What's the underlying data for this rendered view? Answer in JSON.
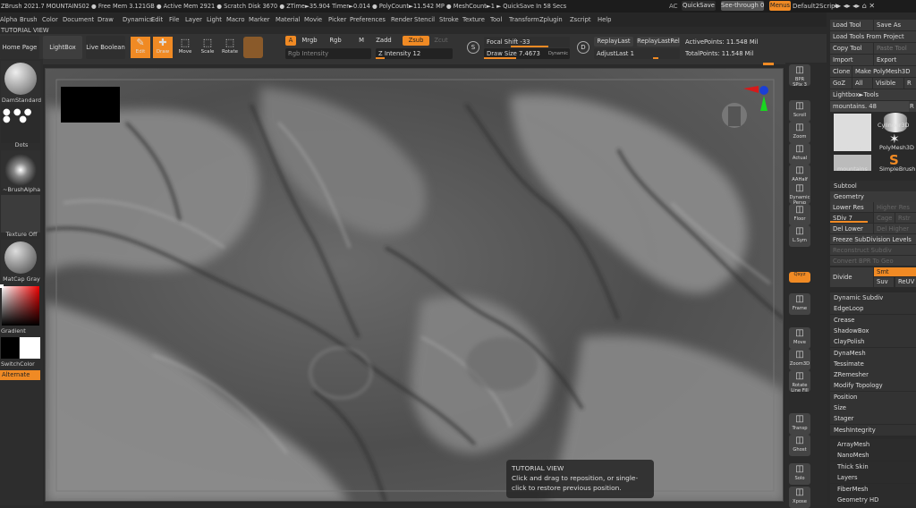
{
  "titlebar": {
    "info": "ZBrush 2021.7   MOUNTAINS02  ● Free Mem 3.121GB ● Active Mem 2921 ● Scratch Disk 3670 ● ZTime►35.904 Timer►0.014 ● PolyCount►11.542 MP  ● MeshCount►1  ► QuickSave In 58 Secs",
    "ac": "AC",
    "quicksave": "QuickSave",
    "seethrough": "See-through  0",
    "menus": "Menus",
    "script": "Default2Script"
  },
  "menubar": [
    "Alpha",
    "Brush",
    "Color",
    "Document",
    "Draw",
    "Dynamics",
    "Edit",
    "File",
    "Layer",
    "Light",
    "Macro",
    "Marker",
    "Material",
    "Movie",
    "Picker",
    "Preferences",
    "Render",
    "Stencil",
    "Stroke",
    "Texture",
    "Tool",
    "Transform",
    "Zplugin",
    "Zscript",
    "Help"
  ],
  "tutorial_label": "TUTORIAL VIEW",
  "shelf": {
    "home": "Home Page",
    "lightbox": "LightBox",
    "liveboolean": "Live Boolean",
    "edit": "Edit",
    "draw": "Draw",
    "move": "Move",
    "scale": "Scale",
    "rotate": "Rotate",
    "a": "A",
    "mrgb": "Mrgb",
    "rgb": "Rgb",
    "m": "M",
    "zadd": "Zadd",
    "zsub": "Zsub",
    "zcut": "Zcut",
    "rgb_intensity": "Rgb Intensity",
    "z_intensity": "Z Intensity 12",
    "z_intensity_value": 12,
    "focal_shift": "Focal Shift -33",
    "draw_size": "Draw Size 7.4673",
    "dynamic": "Dynamic",
    "replaylast": "ReplayLast",
    "replaylastrel": "ReplayLastRel",
    "adjustlast": "AdjustLast 1",
    "active_points": "ActivePoints: 11.548 Mil",
    "total_points": "TotalPoints: 11.548 Mil"
  },
  "left": {
    "brush": "DamStandard",
    "stroke": "Dots",
    "alpha": "~BrushAlpha",
    "texture": "Texture Off",
    "material": "MatCap Gray",
    "gradient": "Gradient",
    "switchcolor": "SwitchColor",
    "alternate": "Alternate"
  },
  "rightstrip": [
    "BPR",
    "SPix 3",
    "Scroll",
    "Zoom",
    "Actual",
    "AAHalf",
    "Dynamic Persp",
    "Floor",
    "L.Sym",
    "Qxyz",
    "Frame",
    "Move",
    "Zoom3D",
    "Rotate",
    "Line Fill",
    "Transp",
    "Ghost",
    "Solo",
    "Xpose"
  ],
  "rightpanel": {
    "load_tool": "Load Tool",
    "save_as": "Save As",
    "load_tools_project": "Load Tools From Project",
    "copy_tool": "Copy Tool",
    "paste_tool": "Paste Tool",
    "import": "Import",
    "export": "Export",
    "clone": "Clone",
    "make_polymesh": "Make PolyMesh3D",
    "goz": "GoZ",
    "all": "All",
    "visible": "Visible",
    "r": "R",
    "lightbox_tools": "Lightbox►Tools",
    "current_tool": "mountains. 48",
    "tools": [
      "mountains",
      "Cylinder3D",
      "PolyMesh3D",
      "mountains",
      "SimpleBrush"
    ],
    "subtool": "Subtool",
    "geometry": "Geometry",
    "lower_res": "Lower Res",
    "higher_res": "Higher Res",
    "sdiv": "SDiv 7",
    "sdiv_value": 7,
    "cage": "Cage",
    "rstr": "Rstr",
    "del_lower": "Del Lower",
    "del_higher": "Del Higher",
    "freeze": "Freeze SubDivision Levels",
    "reconstruct": "Reconstruct Subdiv",
    "convert_bpr": "Convert BPR To Geo",
    "divide": "Divide",
    "smt": "Smt",
    "suv": "Suv",
    "reuv": "ReUV",
    "items": [
      "Dynamic Subdiv",
      "EdgeLoop",
      "Crease",
      "ShadowBox",
      "ClayPolish",
      "DynaMesh",
      "Tessimate",
      "ZRemesher",
      "Modify Topology",
      "Position",
      "Size",
      "Stager",
      "MeshIntegrity"
    ],
    "items2": [
      "ArrayMesh",
      "NanoMesh",
      "Thick Skin",
      "Layers",
      "FiberMesh",
      "Geometry HD"
    ]
  },
  "tooltip": {
    "title": "TUTORIAL VIEW",
    "body": "Click and drag to reposition, or single-click to restore previous position."
  }
}
